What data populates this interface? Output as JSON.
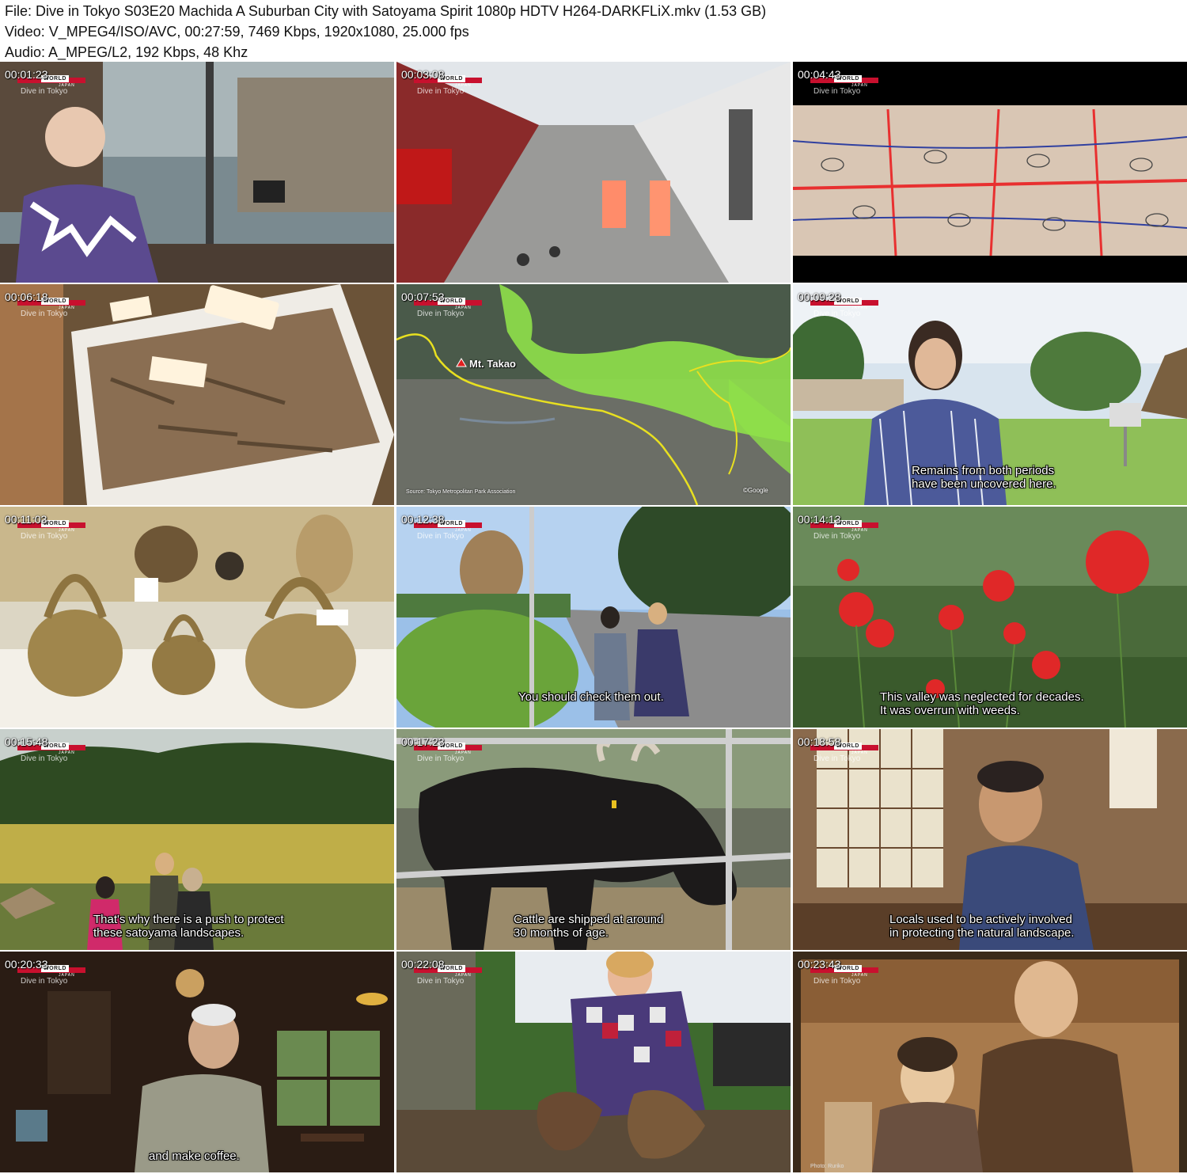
{
  "header": {
    "file_line": "File: Dive in Tokyo S03E20 Machida A Suburban City with Satoyama Spirit 1080p HDTV H264-DARKFLiX.mkv (1.53 GB)",
    "video_line": "Video: V_MPEG4/ISO/AVC, 00:27:59, 7469 Kbps, 1920x1080, 25.000 fps",
    "audio_line": "Audio: A_MPEG/L2, 192 Kbps, 48 Khz"
  },
  "overlay": {
    "logo_text": "WORLD",
    "logo_sub": "JAPAN",
    "program": "Dive in Tokyo"
  },
  "thumbs": [
    {
      "time": "00:01:23",
      "subtitle": ""
    },
    {
      "time": "00:03:08",
      "subtitle": ""
    },
    {
      "time": "00:04:43",
      "subtitle": ""
    },
    {
      "time": "00:06:18",
      "subtitle": ""
    },
    {
      "time": "00:07:53",
      "subtitle": "",
      "map_label": "Mt. Takao",
      "map_source": "Source: Tokyo Metropolitan Park Association",
      "map_credit": "©Google"
    },
    {
      "time": "00:09:28",
      "subtitle": "Remains from both periods\nhave been uncovered here."
    },
    {
      "time": "00:11:03",
      "subtitle": ""
    },
    {
      "time": "00:12:38",
      "subtitle": "You should check them out."
    },
    {
      "time": "00:14:13",
      "subtitle": "This valley was neglected for decades.\nIt was overrun with weeds."
    },
    {
      "time": "00:15:48",
      "subtitle": "That's why there is a push to protect\nthese satoyama landscapes."
    },
    {
      "time": "00:17:23",
      "subtitle": "Cattle are shipped at around\n30 months of age."
    },
    {
      "time": "00:18:58",
      "subtitle": "Locals used to be actively involved\nin protecting the natural landscape."
    },
    {
      "time": "00:20:33",
      "subtitle": "and make coffee."
    },
    {
      "time": "00:22:08",
      "subtitle": ""
    },
    {
      "time": "00:23:43",
      "subtitle": "",
      "photo_credit": "Photo: Ruriko"
    }
  ],
  "colors": {
    "accent_red": "#c8102e",
    "map_green": "#8fe04a",
    "border_yellow": "#e8e020"
  }
}
